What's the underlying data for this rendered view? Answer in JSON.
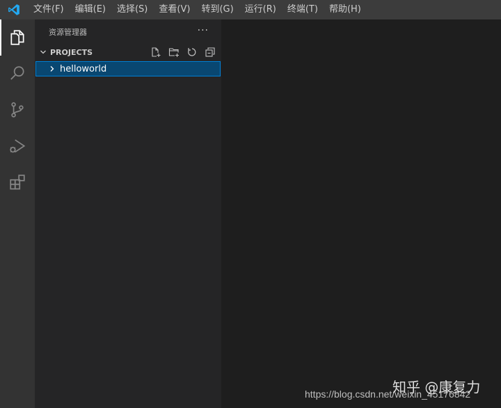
{
  "menu": {
    "items": [
      "文件(F)",
      "编辑(E)",
      "选择(S)",
      "查看(V)",
      "转到(G)",
      "运行(R)",
      "终端(T)",
      "帮助(H)"
    ]
  },
  "activity": {
    "items": [
      {
        "icon": "files-icon",
        "active": true
      },
      {
        "icon": "search-icon",
        "active": false
      },
      {
        "icon": "source-control-icon",
        "active": false
      },
      {
        "icon": "run-debug-icon",
        "active": false
      },
      {
        "icon": "extensions-icon",
        "active": false
      }
    ]
  },
  "sidebar": {
    "title": "资源管理器",
    "more": "···",
    "section": {
      "title": "PROJECTS",
      "actions": [
        "new-file-icon",
        "new-folder-icon",
        "refresh-icon",
        "collapse-all-icon"
      ]
    },
    "tree": [
      {
        "label": "helloworld",
        "expanded": false,
        "selected": true
      }
    ]
  },
  "watermark": {
    "brand": "知乎 @康复力",
    "url": "https://blog.csdn.net/weixin_45176842"
  },
  "colors": {
    "accent": "#007acc",
    "selection": "#094771",
    "focus_border": "#007fd4"
  }
}
